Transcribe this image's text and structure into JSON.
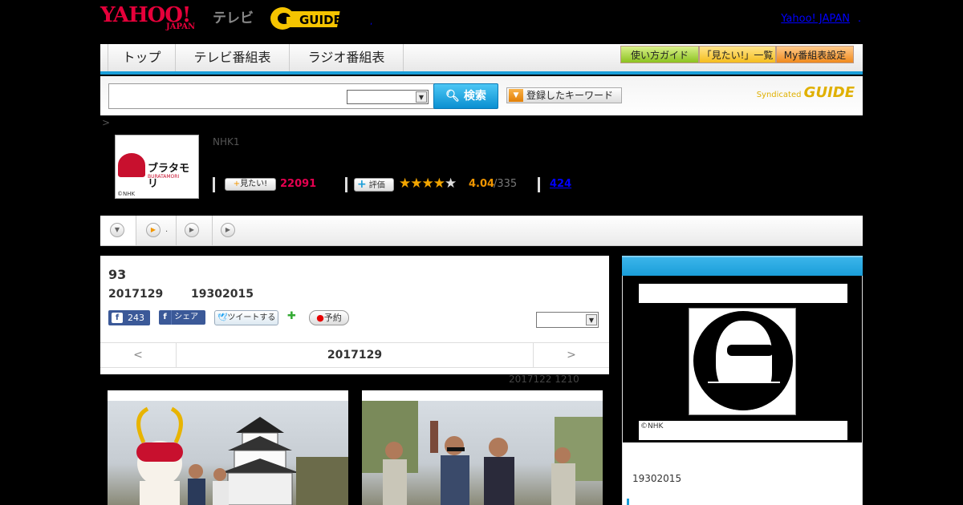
{
  "header": {
    "logo_yahoo": "YAHOO!",
    "logo_japan": "JAPAN",
    "logo_tv": "テレビ",
    "logo_guide": "GUIDE",
    "top_link": "Yahoo! JAPAN",
    "top_dot": ".",
    "small_dot": ","
  },
  "nav": {
    "tabs": [
      "トップ",
      "テレビ番組表",
      "ラジオ番組表"
    ],
    "guide_buttons": [
      "使い方ガイド",
      "「見たい!」一覧",
      "My番組表設定"
    ]
  },
  "search": {
    "button": "検索",
    "keyword_button": "登録したキーワード",
    "syndicated": "Syndicated",
    "syndicated_logo": "GUIDE"
  },
  "breadcrumb": ">",
  "program": {
    "thumb_title": "ブラタモリ",
    "thumb_sub": "BURATAMORI",
    "thumb_credit": "©NHK",
    "channel": "NHK1",
    "mitai_label": "見たい!",
    "mitai_count": "22091",
    "hyoka_label": "評価",
    "rating": "4.04",
    "rating_count": "/335",
    "review_count": "424"
  },
  "subnav": {
    "item_dot": "."
  },
  "episode": {
    "title": "93",
    "date": "2017129",
    "time": "19302015",
    "fb_like_count": "243",
    "fb_share": "シェア",
    "tweet": "ツイートする",
    "reserve": "予約",
    "pager_prev": "<",
    "pager_date": "2017129",
    "pager_next": ">",
    "updated": "2017122  1210"
  },
  "side": {
    "credit": "©NHK",
    "time": "19302015"
  },
  "colors": {
    "accent": "#1a9ed9",
    "brand_red": "#e5003a",
    "mitai": "#e60050",
    "rating": "#f29600"
  }
}
